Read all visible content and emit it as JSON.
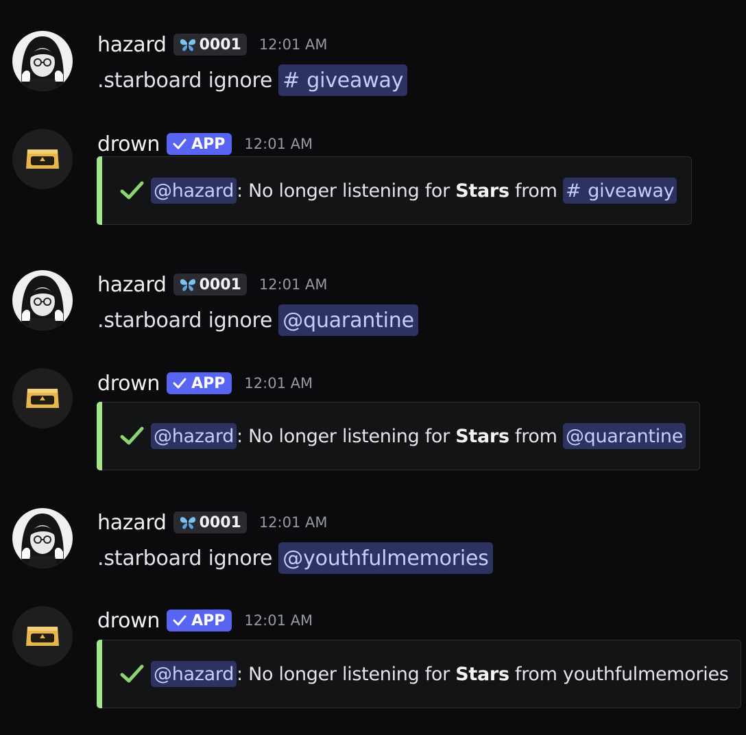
{
  "colors": {
    "background": "#0b0b0e",
    "mention_bg": "#2d3260",
    "mention_text": "#c9cdfb",
    "app_badge": "#5865f2",
    "embed_accent": "#a3e589",
    "check_green": "#8ed46f"
  },
  "icons": {
    "tag_icon": "butterfly-icon",
    "app_check": "checkmark-icon",
    "embed_check": "green-checkmark-icon",
    "hazard_avatar": "anime-girl-avatar",
    "drown_avatar": "golden-goggles-avatar"
  },
  "messages": [
    {
      "author": "hazard",
      "tag": "0001",
      "time": "12:01 AM",
      "text": ".starboard ignore",
      "mention_hash": "#",
      "mention": "giveaway"
    },
    {
      "author": "drown",
      "badge": "APP",
      "time": "12:01 AM",
      "embed": {
        "user_mention": "@hazard",
        "sep": ":",
        "pre": "No longer listening for",
        "bold": "Stars",
        "post": "from",
        "target_hash": "#",
        "target": "giveaway"
      }
    },
    {
      "author": "hazard",
      "tag": "0001",
      "time": "12:01 AM",
      "text": ".starboard ignore",
      "mention": "@quarantine"
    },
    {
      "author": "drown",
      "badge": "APP",
      "time": "12:01 AM",
      "embed": {
        "user_mention": "@hazard",
        "sep": ":",
        "pre": "No longer listening for",
        "bold": "Stars",
        "post": "from",
        "target": "@quarantine"
      }
    },
    {
      "author": "hazard",
      "tag": "0001",
      "time": "12:01 AM",
      "text": ".starboard ignore",
      "mention": "@youthfulmemories"
    },
    {
      "author": "drown",
      "badge": "APP",
      "time": "12:01 AM",
      "embed": {
        "user_mention": "@hazard",
        "sep": ":",
        "pre": "No longer listening for",
        "bold": "Stars",
        "post": "from youthfulmemories"
      }
    }
  ]
}
